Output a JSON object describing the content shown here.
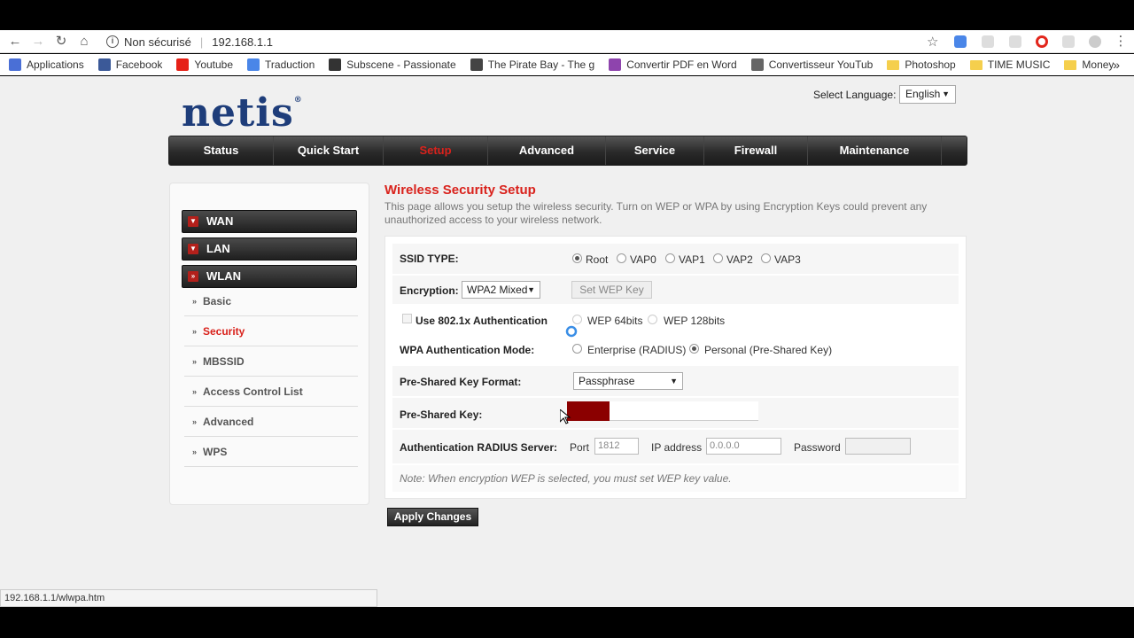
{
  "browser": {
    "security_label": "Non sécurisé",
    "url": "192.168.1.1",
    "bookmarks": [
      {
        "label": "Applications",
        "icon": "apps-grid-icon",
        "color": "#4a6fd6"
      },
      {
        "label": "Facebook",
        "icon": "facebook-icon",
        "color": "#3b5998"
      },
      {
        "label": "Youtube",
        "icon": "youtube-icon",
        "color": "#e62117"
      },
      {
        "label": "Traduction",
        "icon": "translate-icon",
        "color": "#4a86e8"
      },
      {
        "label": "Subscene - Passionate",
        "icon": "subscene-icon",
        "color": "#333333"
      },
      {
        "label": "The Pirate Bay - The g",
        "icon": "pirate-ship-icon",
        "color": "#444444"
      },
      {
        "label": "Convertir PDF en Word",
        "icon": "pdf-convert-icon",
        "color": "#8e44ad"
      },
      {
        "label": "Convertisseur YouTub",
        "icon": "convert-arrows-icon",
        "color": "#666666"
      },
      {
        "label": "Photoshop",
        "icon": "folder-icon",
        "color": "#f5cf4d"
      },
      {
        "label": "TIME MUSIC",
        "icon": "folder-icon",
        "color": "#f5cf4d"
      },
      {
        "label": "Money",
        "icon": "folder-icon",
        "color": "#f5cf4d"
      }
    ],
    "status_url": "192.168.1.1/wlwpa.htm"
  },
  "header": {
    "logo": "netis",
    "logo_mark": "®",
    "language_label": "Select Language:",
    "language_value": "English"
  },
  "nav": {
    "items": [
      "Status",
      "Quick Start",
      "Setup",
      "Advanced",
      "Service",
      "Firewall",
      "Maintenance"
    ],
    "active": "Setup",
    "active_color": "#d9221c"
  },
  "sidebar": {
    "sections": [
      "WAN",
      "LAN",
      "WLAN"
    ],
    "sub_items": [
      "Basic",
      "Security",
      "MBSSID",
      "Access Control List",
      "Advanced",
      "WPS"
    ],
    "active_sub": "Security"
  },
  "content": {
    "title": "Wireless Security Setup",
    "description": "This page allows you setup the wireless security. Turn on WEP or WPA by using Encryption Keys could prevent any unauthorized access to your wireless network.",
    "ssid_type": {
      "label": "SSID TYPE:",
      "options": [
        "Root",
        "VAP0",
        "VAP1",
        "VAP2",
        "VAP3"
      ],
      "selected": "Root"
    },
    "encryption": {
      "label": "Encryption:",
      "value": "WPA2 Mixed",
      "set_wep_key": "Set WEP Key"
    },
    "auth_8021x": {
      "label": "Use 802.1x Authentication",
      "wep64": "WEP 64bits",
      "wep128": "WEP 128bits"
    },
    "wpa_mode": {
      "label": "WPA Authentication Mode:",
      "enterprise": "Enterprise (RADIUS)",
      "personal": "Personal (Pre-Shared Key)",
      "selected": "Personal (Pre-Shared Key)"
    },
    "psk_format": {
      "label": "Pre-Shared Key Format:",
      "value": "Passphrase"
    },
    "psk": {
      "label": "Pre-Shared Key:",
      "redaction_color": "#8b0000"
    },
    "radius": {
      "label": "Authentication RADIUS Server:",
      "port_label": "Port",
      "port_value": "1812",
      "ip_label": "IP address",
      "ip_value": "0.0.0.0",
      "password_label": "Password"
    },
    "note": "Note: When encryption WEP is selected, you must set WEP key value.",
    "apply": "Apply Changes"
  }
}
